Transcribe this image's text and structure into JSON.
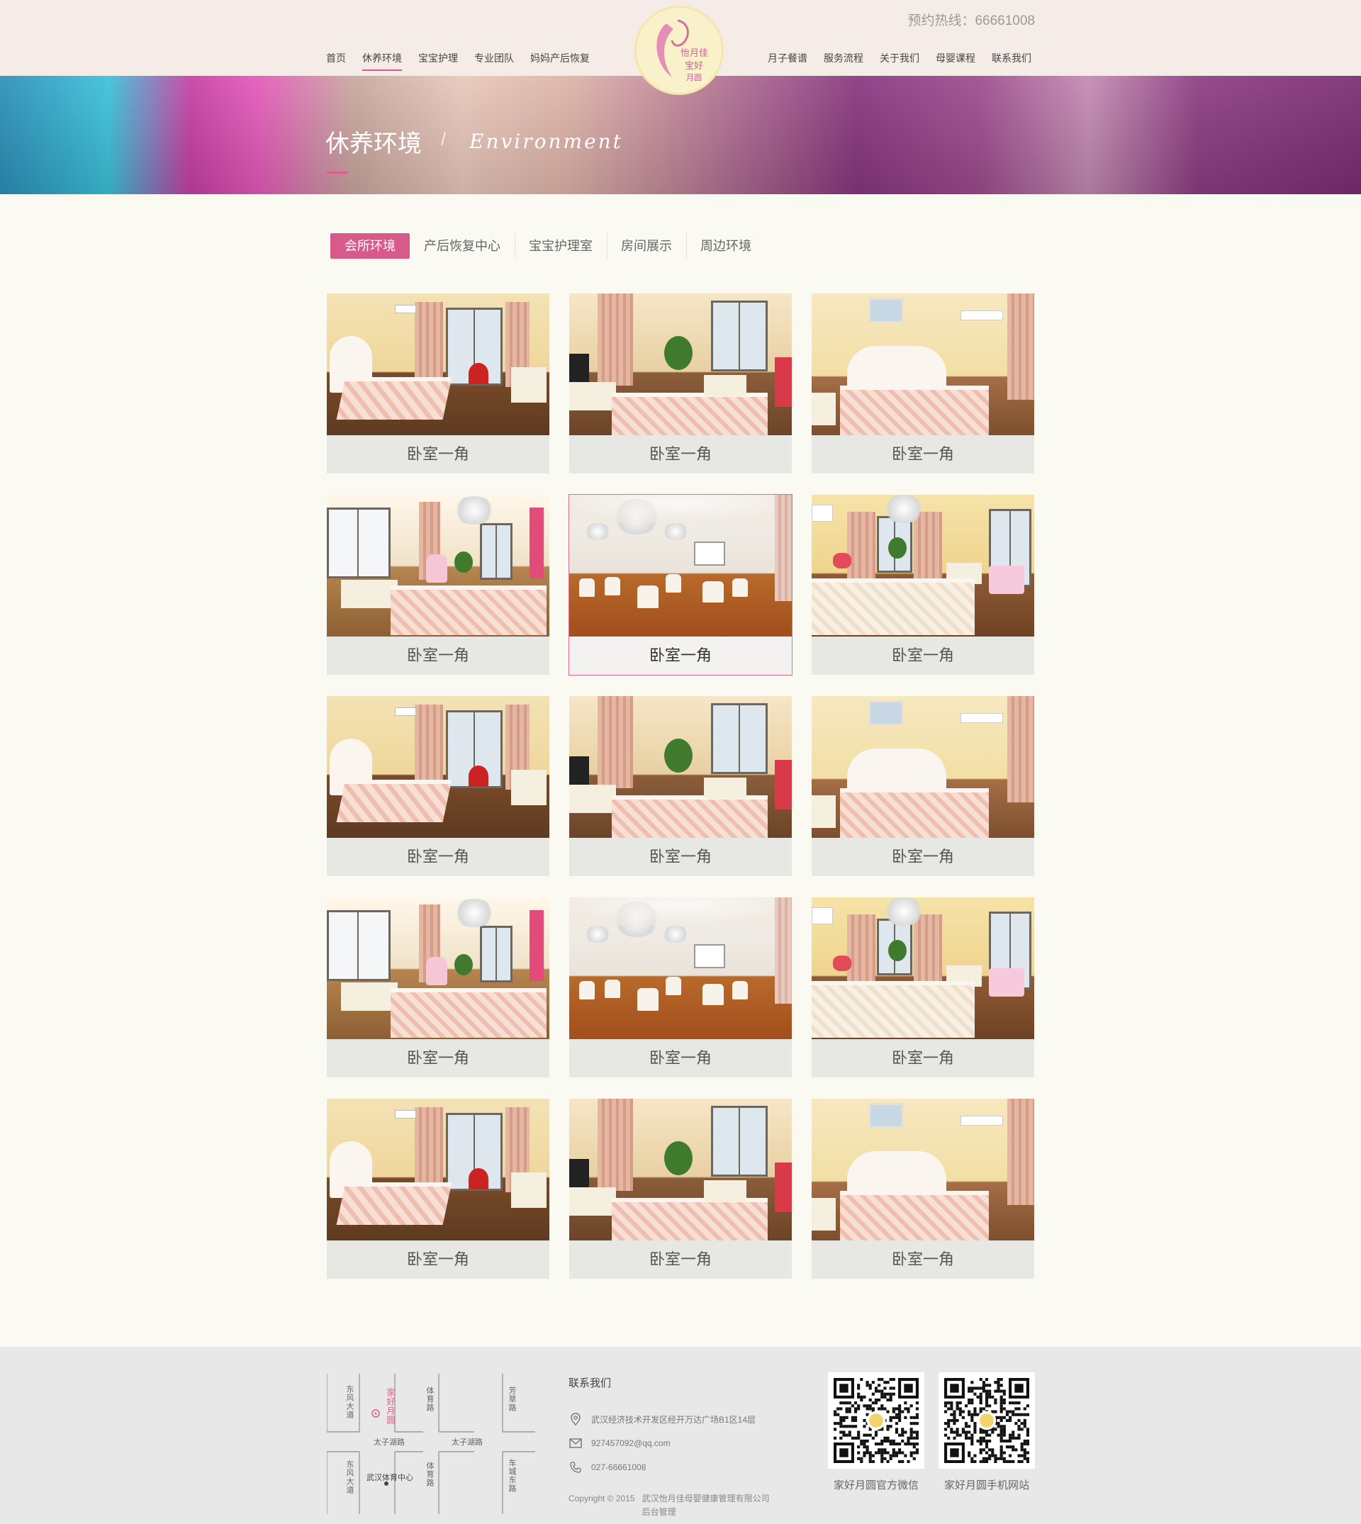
{
  "header": {
    "hotline": "预约热线：66661008",
    "nav_left": [
      "首页",
      "休养环境",
      "宝宝护理",
      "专业团队",
      "妈妈产后恢复"
    ],
    "nav_right": [
      "月子餐谱",
      "服务流程",
      "关于我们",
      "母婴课程",
      "联系我们"
    ],
    "active_nav": "休养环境",
    "logo_text": "怡月佳宝好月圆"
  },
  "banner": {
    "title": "休养环境",
    "separator": "/",
    "subtitle": "Environment"
  },
  "tabs": {
    "items": [
      "会所环境",
      "产后恢复中心",
      "宝宝护理室",
      "房间展示",
      "周边环境"
    ],
    "active": "会所环境"
  },
  "gallery": {
    "items": [
      {
        "caption": "卧室一角",
        "scene": "bedroom-a"
      },
      {
        "caption": "卧室一角",
        "scene": "bedroom-b"
      },
      {
        "caption": "卧室一角",
        "scene": "bedroom-c"
      },
      {
        "caption": "卧室一角",
        "scene": "bedroom-d"
      },
      {
        "caption": "卧室一角",
        "scene": "lounge"
      },
      {
        "caption": "卧室一角",
        "scene": "bedroom-f"
      },
      {
        "caption": "卧室一角",
        "scene": "bedroom-a"
      },
      {
        "caption": "卧室一角",
        "scene": "bedroom-b"
      },
      {
        "caption": "卧室一角",
        "scene": "bedroom-c"
      },
      {
        "caption": "卧室一角",
        "scene": "bedroom-d"
      },
      {
        "caption": "卧室一角",
        "scene": "lounge"
      },
      {
        "caption": "卧室一角",
        "scene": "bedroom-f"
      },
      {
        "caption": "卧室一角",
        "scene": "bedroom-a"
      },
      {
        "caption": "卧室一角",
        "scene": "bedroom-b"
      },
      {
        "caption": "卧室一角",
        "scene": "bedroom-c"
      }
    ],
    "highlighted_index": 4
  },
  "footer": {
    "map": {
      "roads": [
        "东风大道",
        "体育路",
        "芳草路",
        "太子湖路",
        "太子湖路",
        "东风大道",
        "体育路",
        "车城东路"
      ],
      "place_marker": "家好月圆",
      "landmark": "武汉体育中心"
    },
    "contact": {
      "title": "联系我们",
      "address": "武汉经济技术开发区经开万达广场B1区14层",
      "email": "927457092@qq.com",
      "phone": "027-66661008",
      "copyright": "Copyright © 2015",
      "company": "武汉怡月佳母婴健康管理有限公司",
      "admin_link": "后台管理"
    },
    "qrcodes": [
      {
        "caption": "家好月圆官方微信"
      },
      {
        "caption": "家好月圆手机网站"
      }
    ]
  },
  "colors": {
    "accent": "#d85a8a",
    "header_bg": "#f5ebe7",
    "page_bg": "#fafaf3",
    "footer_bg": "#e8e8e8"
  }
}
